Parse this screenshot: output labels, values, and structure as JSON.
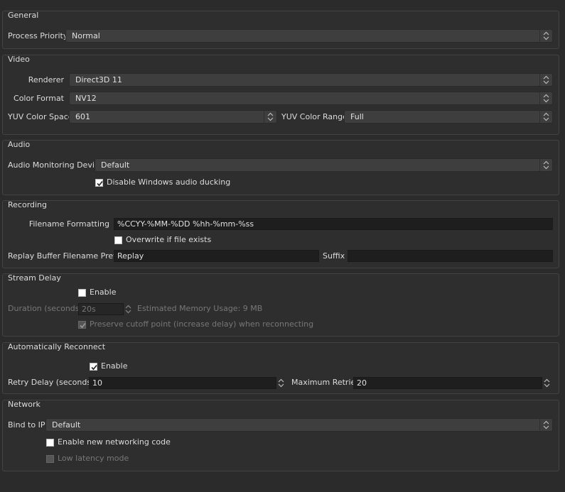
{
  "general": {
    "title": "General",
    "process_priority_label": "Process Priority",
    "process_priority_value": "Normal"
  },
  "video": {
    "title": "Video",
    "renderer_label": "Renderer",
    "renderer_value": "Direct3D 11",
    "color_format_label": "Color Format",
    "color_format_value": "NV12",
    "yuv_color_space_label": "YUV Color Space",
    "yuv_color_space_value": "601",
    "yuv_color_range_label": "YUV Color Range",
    "yuv_color_range_value": "Full"
  },
  "audio": {
    "title": "Audio",
    "monitoring_device_label": "Audio Monitoring Device",
    "monitoring_device_value": "Default",
    "disable_ducking_label": "Disable Windows audio ducking",
    "disable_ducking_checked": true
  },
  "recording": {
    "title": "Recording",
    "filename_formatting_label": "Filename Formatting",
    "filename_formatting_value": "%CCYY-%MM-%DD %hh-%mm-%ss",
    "overwrite_label": "Overwrite if file exists",
    "overwrite_checked": false,
    "replay_prefix_label": "Replay Buffer Filename Prefix",
    "replay_prefix_value": "Replay",
    "suffix_label": "Suffix",
    "suffix_value": ""
  },
  "stream_delay": {
    "title": "Stream Delay",
    "enable_label": "Enable",
    "enable_checked": false,
    "duration_label": "Duration (seconds)",
    "duration_value": "20s",
    "estimated_memory": "Estimated Memory Usage: 9 MB",
    "preserve_label": "Preserve cutoff point (increase delay) when reconnecting",
    "preserve_checked": true
  },
  "auto_reconnect": {
    "title": "Automatically Reconnect",
    "enable_label": "Enable",
    "enable_checked": true,
    "retry_delay_label": "Retry Delay (seconds)",
    "retry_delay_value": "10",
    "max_retries_label": "Maximum Retries",
    "max_retries_value": "20"
  },
  "network": {
    "title": "Network",
    "bind_ip_label": "Bind to IP",
    "bind_ip_value": "Default",
    "new_networking_label": "Enable new networking code",
    "new_networking_checked": false,
    "low_latency_label": "Low latency mode",
    "low_latency_checked": false
  },
  "colors": {
    "background": "#2b2b2b",
    "group_border": "#434343",
    "combo_bg": "#3e3e3e",
    "field_bg": "#1e1e1e",
    "text": "#dcdcdc",
    "disabled_text": "#777777"
  }
}
